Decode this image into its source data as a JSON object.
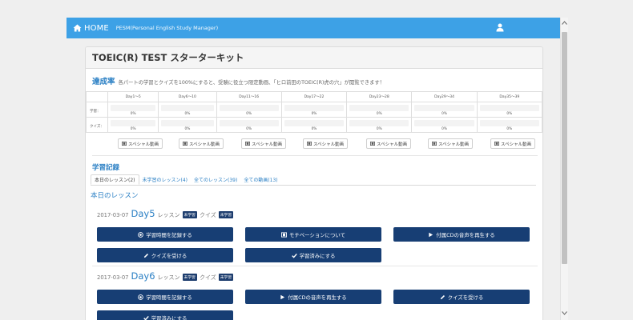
{
  "nav": {
    "home_label": "HOME",
    "brand": "PESM(Personal English Study Manager)"
  },
  "colors": {
    "nav_blue": "#3da1e6",
    "accent_blue": "#2a7fc4",
    "dark_button": "#173e74",
    "badge_dark": "#1d3d6e"
  },
  "panel": {
    "title": "TOEIC(R) TEST スターターキット"
  },
  "achievement": {
    "title": "達成率",
    "description": "各パートの学習とクイズを100%にすると、受験に役立つ限定動画、「ヒロ前田のTOEIC(R)虎の穴」が閲覧できます！",
    "columns": [
      "Day1～5",
      "Day6～10",
      "Day11～16",
      "Day17～22",
      "Day23～28",
      "Day29～34",
      "Day35～39"
    ],
    "rows": [
      {
        "label": "学習：",
        "values": [
          "0%",
          "0%",
          "0%",
          "0%",
          "0%",
          "0%",
          "0%"
        ],
        "progress": [
          0,
          0,
          0,
          0,
          0,
          0,
          0
        ]
      },
      {
        "label": "クイズ：",
        "values": [
          "0%",
          "0%",
          "0%",
          "0%",
          "0%",
          "0%",
          "0%"
        ],
        "progress": [
          0,
          0,
          0,
          0,
          0,
          0,
          0
        ]
      }
    ],
    "video_label": "スペシャル動画"
  },
  "record": {
    "title": "学習記録",
    "tabs": [
      "本日のレッスン(2)",
      "未学習のレッスン(4)",
      "全てのレッスン(39)",
      "全ての動画(13)"
    ],
    "section_title": "本日のレッスン",
    "lesson_word": "レッスン",
    "quiz_word": "クイズ",
    "badge_label": "未学習",
    "lessons": [
      {
        "date": "2017-03-07",
        "day": "Day5",
        "buttons": [
          {
            "label": "学習時間を記録する",
            "icon": "record-icon"
          },
          {
            "label": "モチベーションについて",
            "icon": "film-icon"
          },
          {
            "label": "付属CDの音声を再生する",
            "icon": "play-icon"
          },
          {
            "label": "クイズを受ける",
            "icon": "pencil-icon"
          },
          {
            "label": "学習済みにする",
            "icon": "check-icon"
          }
        ]
      },
      {
        "date": "2017-03-07",
        "day": "Day6",
        "buttons": [
          {
            "label": "学習時間を記録する",
            "icon": "record-icon"
          },
          {
            "label": "付属CDの音声を再生する",
            "icon": "play-icon"
          },
          {
            "label": "クイズを受ける",
            "icon": "pencil-icon"
          },
          {
            "label": "学習済みにする",
            "icon": "check-icon"
          }
        ]
      }
    ]
  }
}
